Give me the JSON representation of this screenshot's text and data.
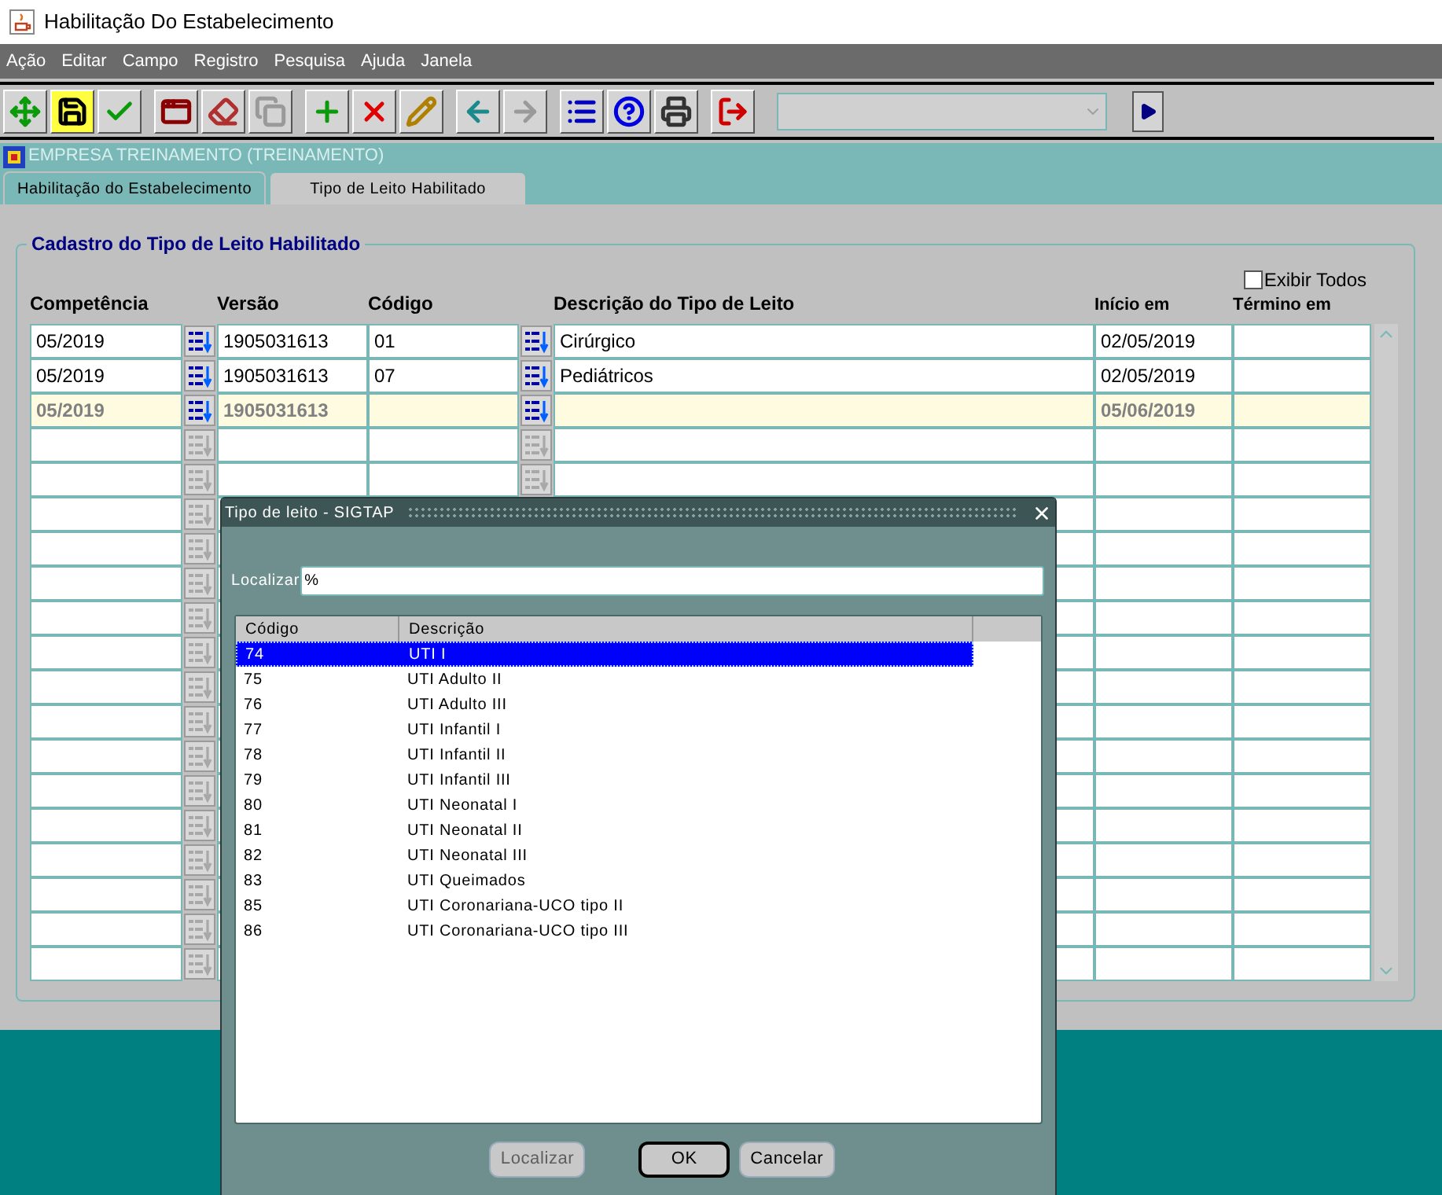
{
  "window": {
    "title": "Habilitação Do Estabelecimento"
  },
  "menu": [
    "Ação",
    "Editar",
    "Campo",
    "Registro",
    "Pesquisa",
    "Ajuda",
    "Janela"
  ],
  "toolbar": [
    [
      {
        "kind": "move",
        "disabled": false
      },
      {
        "kind": "save",
        "disabled": false
      },
      {
        "kind": "commit",
        "disabled": false
      }
    ],
    [
      {
        "kind": "clear_form",
        "disabled": false
      },
      {
        "kind": "clear_record",
        "disabled": false
      },
      {
        "kind": "duplicate",
        "disabled": true
      }
    ],
    [
      {
        "kind": "insert",
        "disabled": false
      },
      {
        "kind": "delete",
        "disabled": false
      },
      {
        "kind": "edit",
        "disabled": false
      }
    ],
    [
      {
        "kind": "previous",
        "disabled": false
      },
      {
        "kind": "next",
        "disabled": true
      }
    ],
    [
      {
        "kind": "list",
        "disabled": false
      },
      {
        "kind": "help",
        "disabled": false
      },
      {
        "kind": "print",
        "disabled": false
      }
    ],
    [
      {
        "kind": "exit",
        "disabled": false
      }
    ]
  ],
  "company": "EMPRESA TREINAMENTO (TREINAMENTO)",
  "tabs": [
    {
      "label": "Habilitação do Estabelecimento",
      "selected": false
    },
    {
      "label": "Tipo de Leito Habilitado",
      "selected": true
    }
  ],
  "form": {
    "title": "Cadastro do Tipo de Leito Habilitado",
    "show_all": {
      "label": "Exibir Todos",
      "checked": false
    },
    "columns": [
      "Competência",
      "Versão",
      "Código",
      "Descrição do Tipo de Leito",
      "Início em",
      "Término em"
    ],
    "rows": [
      {
        "competencia": "05/2019",
        "versao": "1905031613",
        "codigo": "01",
        "descricao": "Cirúrgico",
        "inicio": "02/05/2019",
        "current": false,
        "lookup": true
      },
      {
        "competencia": "05/2019",
        "versao": "1905031613",
        "codigo": "07",
        "descricao": "Pediátricos",
        "inicio": "02/05/2019",
        "current": false,
        "lookup": true
      },
      {
        "competencia": "05/2019",
        "versao": "1905031613",
        "inicio": "05/06/2019",
        "current": true,
        "lookup": true
      },
      {
        "current": false,
        "lookup": false
      },
      {
        "current": false,
        "lookup": false
      },
      {
        "current": false,
        "lookup": false
      },
      {
        "current": false,
        "lookup": false
      },
      {
        "current": false,
        "lookup": false
      },
      {
        "current": false,
        "lookup": false
      },
      {
        "current": false,
        "lookup": false
      },
      {
        "current": false,
        "lookup": false
      },
      {
        "current": false,
        "lookup": false
      },
      {
        "current": false,
        "lookup": false
      },
      {
        "current": false,
        "lookup": false
      },
      {
        "current": false,
        "lookup": false
      },
      {
        "current": false,
        "lookup": false
      },
      {
        "current": false,
        "lookup": false
      },
      {
        "current": false,
        "lookup": false
      },
      {
        "current": false,
        "lookup": false
      }
    ]
  },
  "dialog": {
    "title": "Tipo de leito - SIGTAP",
    "search": {
      "label": "Localizar",
      "value": "%"
    },
    "columns": [
      "Código",
      "Descrição"
    ],
    "items": [
      {
        "code": "74",
        "description": "UTI I",
        "selected": true
      },
      {
        "code": "75",
        "description": "UTI Adulto II",
        "selected": false
      },
      {
        "code": "76",
        "description": "UTI Adulto III",
        "selected": false
      },
      {
        "code": "77",
        "description": "UTI Infantil I",
        "selected": false
      },
      {
        "code": "78",
        "description": "UTI Infantil II",
        "selected": false
      },
      {
        "code": "79",
        "description": "UTI Infantil III",
        "selected": false
      },
      {
        "code": "80",
        "description": "UTI Neonatal I",
        "selected": false
      },
      {
        "code": "81",
        "description": "UTI Neonatal II",
        "selected": false
      },
      {
        "code": "82",
        "description": "UTI Neonatal III",
        "selected": false
      },
      {
        "code": "83",
        "description": "UTI Queimados",
        "selected": false
      },
      {
        "code": "85",
        "description": "UTI Coronariana-UCO tipo II",
        "selected": false
      },
      {
        "code": "86",
        "description": "UTI Coronariana-UCO tipo III",
        "selected": false
      }
    ],
    "buttons": [
      {
        "label": "Localizar",
        "disabled": true,
        "default": false
      },
      {
        "label": "OK",
        "disabled": false,
        "default": true
      },
      {
        "label": "Cancelar",
        "disabled": false,
        "default": false
      }
    ]
  }
}
